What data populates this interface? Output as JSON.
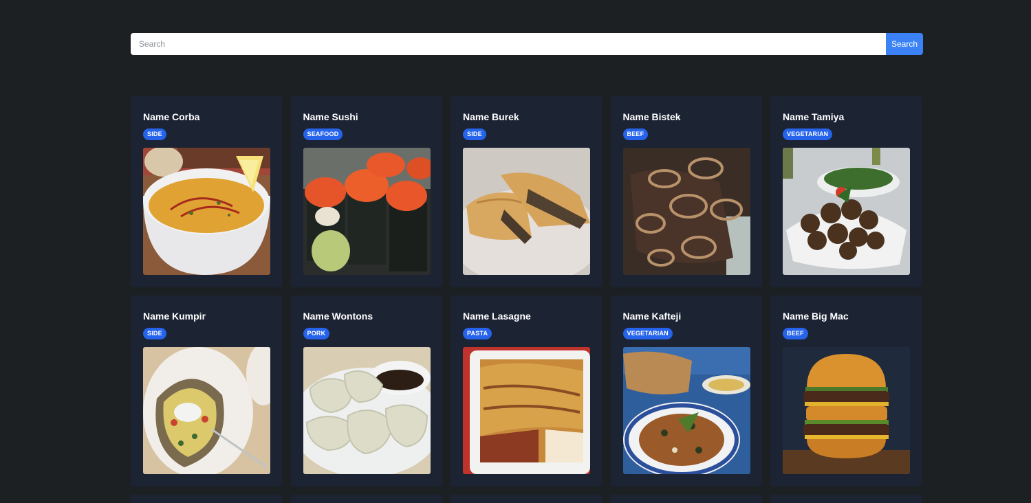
{
  "search": {
    "placeholder": "Search",
    "button_label": "Search"
  },
  "meals": [
    {
      "title": "Name Corba",
      "category": "SIDE",
      "image": "soup-photo"
    },
    {
      "title": "Name Sushi",
      "category": "SEAFOOD",
      "image": "sushi-photo"
    },
    {
      "title": "Name Burek",
      "category": "SIDE",
      "image": "pastry-photo"
    },
    {
      "title": "Name Bistek",
      "category": "BEEF",
      "image": "steak-onions-photo"
    },
    {
      "title": "Name Tamiya",
      "category": "VEGETARIAN",
      "image": "falafel-photo"
    },
    {
      "title": "Name Kumpir",
      "category": "SIDE",
      "image": "baked-potato-photo"
    },
    {
      "title": "Name Wontons",
      "category": "PORK",
      "image": "dumplings-photo"
    },
    {
      "title": "Name Lasagne",
      "category": "PASTA",
      "image": "lasagne-photo"
    },
    {
      "title": "Name Kafteji",
      "category": "VEGETARIAN",
      "image": "vegetable-stew-photo"
    },
    {
      "title": "Name Big Mac",
      "category": "BEEF",
      "image": "burger-photo"
    }
  ],
  "colors": {
    "background": "#1d2022",
    "card": "#1c2333",
    "accent": "#3b82f6",
    "badge": "#2563eb"
  }
}
